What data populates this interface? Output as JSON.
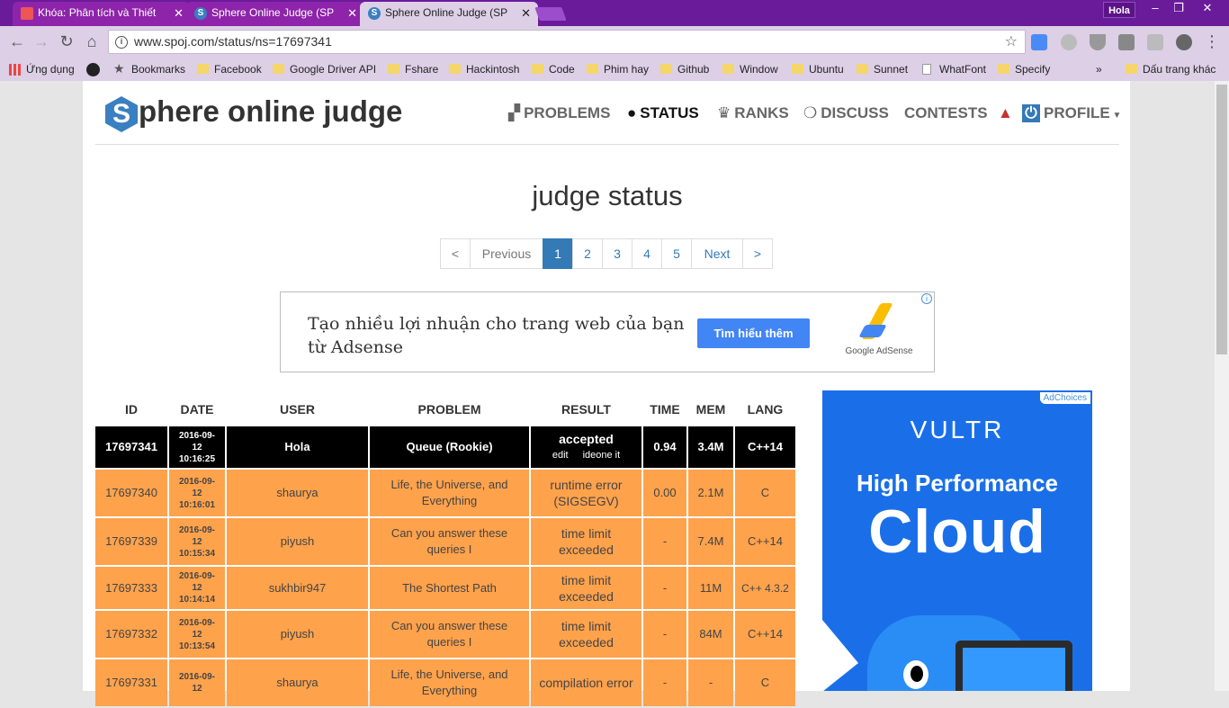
{
  "browser": {
    "tabs": [
      {
        "label": "Khóa: Phân tích và Thiết",
        "active": false,
        "icon": "fire-icon"
      },
      {
        "label": "Sphere Online Judge (SP",
        "active": false,
        "icon": "spoj-icon"
      },
      {
        "label": "Sphere Online Judge (SP",
        "active": true,
        "icon": "spoj-icon"
      }
    ],
    "profile_name": "Hola",
    "url": "www.spoj.com/status/ns=17697341",
    "bookmarks": [
      {
        "label": "Ứng dụng",
        "icon": "apps-icon"
      },
      {
        "label": "",
        "icon": "github-icon"
      },
      {
        "label": "Bookmarks",
        "icon": "star-icon"
      },
      {
        "label": "Facebook",
        "icon": "folder-icon"
      },
      {
        "label": "Google Driver API",
        "icon": "folder-icon"
      },
      {
        "label": "Fshare",
        "icon": "folder-icon"
      },
      {
        "label": "Hackintosh",
        "icon": "folder-icon"
      },
      {
        "label": "Code",
        "icon": "folder-icon"
      },
      {
        "label": "Phim hay",
        "icon": "folder-icon"
      },
      {
        "label": "Github",
        "icon": "folder-icon"
      },
      {
        "label": "Window",
        "icon": "folder-icon"
      },
      {
        "label": "Ubuntu",
        "icon": "folder-icon"
      },
      {
        "label": "Sunnet",
        "icon": "folder-icon"
      },
      {
        "label": "WhatFont",
        "icon": "page-icon"
      },
      {
        "label": "Specify",
        "icon": "folder-icon"
      }
    ],
    "more_bookmarks": "»",
    "other_bookmarks": "Dấu trang khác"
  },
  "site": {
    "logo_letter": "S",
    "logo_text": "phere online judge",
    "nav": {
      "problems": "PROBLEMS",
      "status": "STATUS",
      "ranks": "RANKS",
      "discuss": "DISCUSS",
      "contests": "CONTESTS",
      "profile": "PROFILE"
    }
  },
  "page_title": "judge status",
  "pagination": {
    "first": "<",
    "previous": "Previous",
    "pages": [
      "1",
      "2",
      "3",
      "4",
      "5"
    ],
    "current": "1",
    "next": "Next",
    "last": ">"
  },
  "ad": {
    "text": "Tạo nhiều lợi nhuận cho trang web của bạn từ Adsense",
    "button": "Tìm hiểu thêm",
    "brand": "Google AdSense",
    "info": "i"
  },
  "table": {
    "headers": [
      "ID",
      "DATE",
      "USER",
      "PROBLEM",
      "RESULT",
      "TIME",
      "MEM",
      "LANG"
    ],
    "rows": [
      {
        "id": "17697341",
        "date_d": "2016-09-",
        "date_m": "12",
        "date_t": "10:16:25",
        "user": "Hola",
        "problem": "Queue (Rookie)",
        "result": "accepted",
        "link_edit": "edit",
        "link_ideone": "ideone it",
        "time": "0.94",
        "mem": "3.4M",
        "lang": "C++14"
      },
      {
        "id": "17697340",
        "date_d": "2016-09-",
        "date_m": "12",
        "date_t": "10:16:01",
        "user": "shaurya",
        "problem": "Life, the Universe, and Everything",
        "result": "runtime error (SIGSEGV)",
        "time": "0.00",
        "mem": "2.1M",
        "lang": "C"
      },
      {
        "id": "17697339",
        "date_d": "2016-09-",
        "date_m": "12",
        "date_t": "10:15:34",
        "user": "piyush",
        "problem": "Can you answer these queries I",
        "result": "time limit exceeded",
        "time": "-",
        "mem": "7.4M",
        "lang": "C++14"
      },
      {
        "id": "17697333",
        "date_d": "2016-09-",
        "date_m": "12",
        "date_t": "10:14:14",
        "user": "sukhbir947",
        "problem": "The Shortest Path",
        "result": "time limit exceeded",
        "time": "-",
        "mem": "11M",
        "lang": "C++ 4.3.2"
      },
      {
        "id": "17697332",
        "date_d": "2016-09-",
        "date_m": "12",
        "date_t": "10:13:54",
        "user": "piyush",
        "problem": "Can you answer these queries I",
        "result": "time limit exceeded",
        "time": "-",
        "mem": "84M",
        "lang": "C++14"
      },
      {
        "id": "17697331",
        "date_d": "2016-09-",
        "date_m": "12",
        "date_t": "",
        "user": "shaurya",
        "problem": "Life, the Universe, and Everything",
        "result": "compilation error",
        "time": "-",
        "mem": "-",
        "lang": "C"
      }
    ]
  },
  "side_ad": {
    "adchoices": "AdChoices",
    "brand": "VULTR",
    "headline": "High Performance",
    "big": "Cloud"
  },
  "colors": {
    "chrome_purple": "#6a1b9a",
    "row_orange": "#ffa24c",
    "accent_blue": "#337ab7"
  }
}
